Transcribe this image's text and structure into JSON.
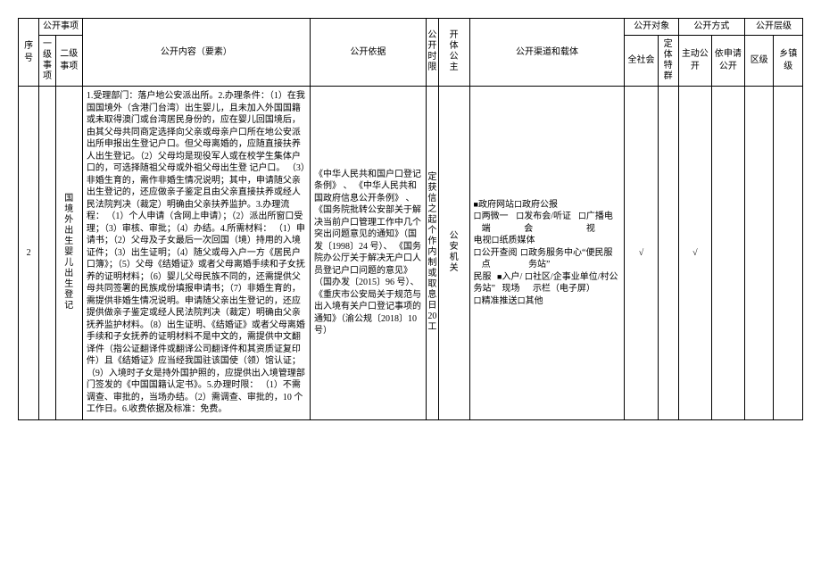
{
  "headers": {
    "seq": "序号",
    "item_group": "公开事项",
    "cat1": "一级事项",
    "cat2": "二级事项",
    "content": "公开内容（要素）",
    "basis": "公开依据",
    "time": "公开时限",
    "subject": "开体公主",
    "channel": "公开渠道和载体",
    "target_group": "公开对象",
    "target_all": "全社会",
    "target_spec": "定体特群",
    "method_group": "公开方式",
    "method_active": "主动公开",
    "method_request": "依申请公开",
    "level_group": "公开层级",
    "level_district": "区级",
    "level_town": "乡镇级"
  },
  "row": {
    "seq": "2",
    "cat1": "",
    "cat2": "国境外出生婴儿出生登记",
    "content": "1.受理部门：落户地公安派出所。2.办理条件：（1）在我国国境外（含港门台湾）出生婴儿，且未加入外国国籍或未取得澳门或台湾居民身份的，应在婴儿回国境后，由其父母共同商定选择向父亲或母亲户口所在地公安派出所申报出生登记户口。但父母离婚的，应随直接扶养人出生登记。（2）父母均是现役军人或在校学生集体户口的，可选择随祖父母或外祖父母出生登\n记户口。 （3）非婚生育的，需作非婚生情况说明；其中，申请随父亲出生登记的，还应做亲子鉴定且由父亲直接扶养或经人民法院判决（裁定）明确由父亲扶养监护。3.办理流程： （1）个人申请（含网上申请）；（2）派出所窗口受理；（3）审核、审批；（4）办结。4.所需材料： （1）申请书；（2）父母及子女最后一次回国（境）持用的入境证件；（3）出生证明；（4）随父或母入户一方《居民户口簿》；（5）父母《结婚证》或者父母离婚手续和子女抚养的证明材料；（6）婴儿父母民族不同的，还需提供父母共同签署的民族成份填报申请书；（7）非婚生育的，需提供非婚生情况说明。申请随父亲出生登记的，还应提供做亲子鉴定或经人民法院判决（裁定）明确由父亲\n抚养监护材料。（8）出生证明、《结婚证》或者父母离婚手续和子女抚养的证明材料不是中文的，需提供中文翻译件（指公证翻译件或翻译公司翻译件和其资质证复印件）且《结婚证》应当经我国驻该国使（领）馆认证；（9）入境时子女是持外国护照的，应提供出入境管理部门签发的《中国国籍认定书》。5.办理时限： （1）不需调查、审批的，当场办结。（2）需调查、审批的，10 个工作日。6.收费依据及标准：免费。",
    "basis": "《中华人民共和国户口登记条例》 、 《中华人民共和国政府信息公开条例》 、《国务院批转公安部关于解决当前户口管理工作中几个突出问题意见的通知》（国发〔1998〕24 号）、\n《国务院办公厅关于解决无户口人员登记户口问题的意见》（国办发〔2015〕96 号）、《重庆市公安局关于规范与出入境有关户口登记事项的通知》（渝公规〔2018〕10 号）",
    "time": "定获信之起个作内制或取息日20工",
    "subject": "公安机关",
    "channels": {
      "c1": {
        "checked": true,
        "label": "政府网站"
      },
      "c2": {
        "checked": false,
        "label": "政府公报"
      },
      "c3": {
        "checked": false,
        "label": "两微一端"
      },
      "c4": {
        "checked": false,
        "label": "发布会/听证会"
      },
      "c5": {
        "checked": false,
        "label": "广播电视"
      },
      "c6": {
        "checked": false,
        "label": "纸质媒体"
      },
      "c7": {
        "checked": false,
        "label": "公开查阅点"
      },
      "c8": {
        "checked": false,
        "label": "政务服务中心“便民服务站”"
      },
      "c9": {
        "checked": true,
        "label": "入户/现场"
      },
      "c10": {
        "checked": false,
        "label": "社区/企事业单位/村公示栏（电子屏）"
      },
      "c11": {
        "checked": false,
        "label": "精准推送"
      },
      "c12": {
        "checked": false,
        "label": "其他"
      }
    },
    "target_all": "√",
    "target_spec": "",
    "method_active": "√",
    "method_request": "",
    "level_district": "",
    "level_town": ""
  },
  "symbols": {
    "checked": "■",
    "unchecked": "口"
  }
}
